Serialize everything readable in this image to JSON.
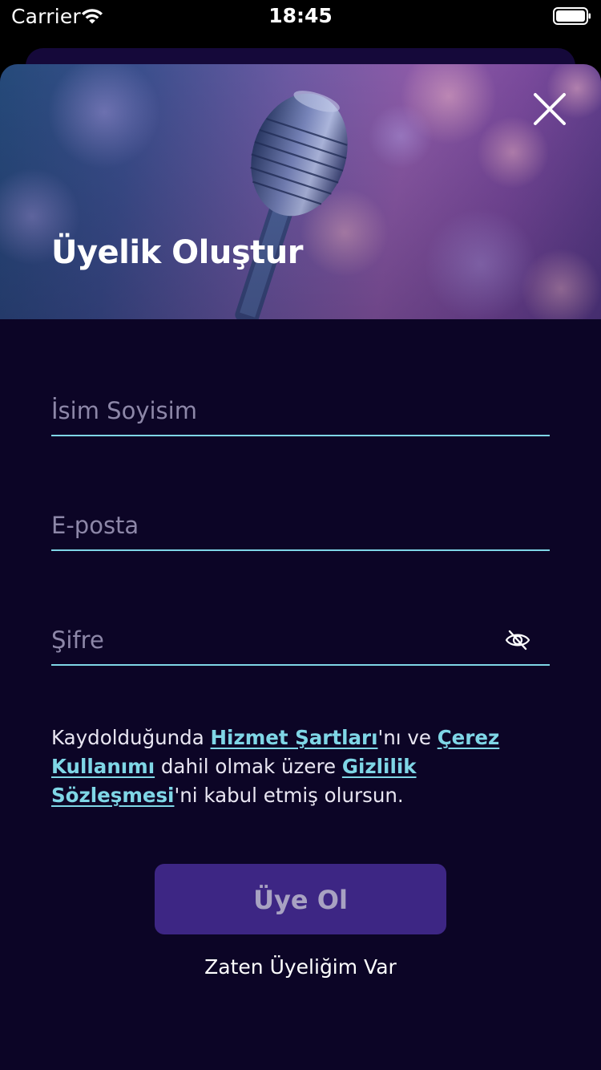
{
  "status_bar": {
    "carrier": "Carrier",
    "time": "18:45",
    "wifi_icon": "wifi-icon",
    "battery_icon": "battery-full-icon"
  },
  "hero": {
    "title": "Üyelik Oluştur",
    "close_icon": "close-icon",
    "background": "microphone-photo"
  },
  "form": {
    "name_placeholder": "İsim Soyisim",
    "name_value": "",
    "email_placeholder": "E-posta",
    "email_value": "",
    "password_placeholder": "Şifre",
    "password_value": "",
    "password_toggle_icon": "eye-slash-icon"
  },
  "terms": {
    "part1": "Kaydolduğunda ",
    "link_terms": "Hizmet Şartları",
    "part2": "'nı ve ",
    "link_cookies": "Çerez Kullanımı",
    "part3": " dahil olmak üzere ",
    "link_privacy": "Gizlilik Sözleşmesi",
    "part4": "'ni kabul etmiş olursun."
  },
  "actions": {
    "signup_label": "Üye Ol",
    "login_label": "Zaten Üyeliğim Var"
  },
  "colors": {
    "background": "#0c0526",
    "accent": "#7fd6e6",
    "button": "#3d2684",
    "button_text": "#a8a2c2"
  }
}
